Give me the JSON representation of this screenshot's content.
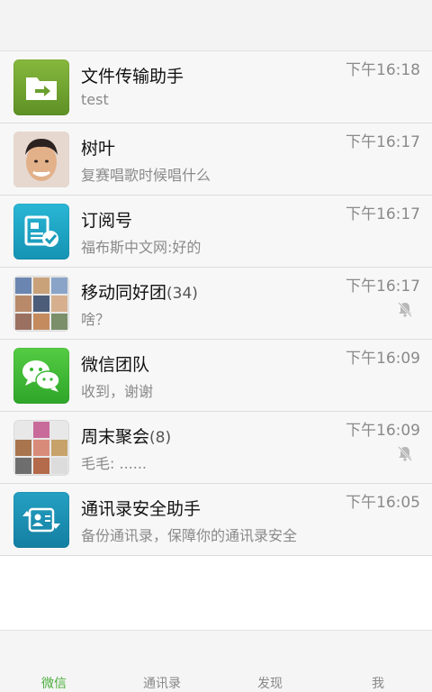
{
  "chats": [
    {
      "name": "文件传输助手",
      "count": "",
      "preview": "test",
      "time": "下午16:18",
      "muted": false,
      "avatar": "file-transfer-icon"
    },
    {
      "name": "树叶",
      "count": "",
      "preview": "复赛唱歌时候唱什么",
      "time": "下午16:17",
      "muted": false,
      "avatar": "person-photo"
    },
    {
      "name": "订阅号",
      "count": "",
      "preview": "福布斯中文网:好的",
      "time": "下午16:17",
      "muted": false,
      "avatar": "subscription-icon"
    },
    {
      "name": "移动同好团",
      "count": "(34)",
      "preview": "啥？",
      "time": "下午16:17",
      "muted": true,
      "avatar": "group-collage"
    },
    {
      "name": "微信团队",
      "count": "",
      "preview": "收到，谢谢",
      "time": "下午16:09",
      "muted": false,
      "avatar": "wechat-icon"
    },
    {
      "name": "周末聚会",
      "count": "(8)",
      "preview": "毛毛: ......",
      "time": "下午16:09",
      "muted": true,
      "avatar": "group-collage"
    },
    {
      "name": "通讯录安全助手",
      "count": "",
      "preview": "备份通讯录，保障你的通讯录安全",
      "time": "下午16:05",
      "muted": false,
      "avatar": "contact-backup-icon"
    }
  ],
  "tabs": [
    "微信",
    "通讯录",
    "发现",
    "我"
  ],
  "colors": {
    "accent": "#4aae3c",
    "file": "#6aa22c",
    "subscription": "#19a4c6",
    "wechat": "#3ab834",
    "security": "#1b8fb2"
  }
}
